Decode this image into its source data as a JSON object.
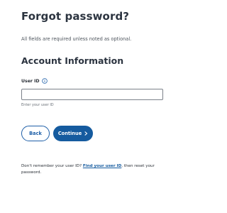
{
  "page": {
    "title": "Forgot password?",
    "required_note": "All fields are required unless noted as optional."
  },
  "section": {
    "title": "Account Information"
  },
  "user_id_field": {
    "label": "User ID",
    "value": "",
    "placeholder": "",
    "helper_text": "Enter your user ID"
  },
  "buttons": {
    "back_label": "Back",
    "continue_label": "Continue"
  },
  "footer": {
    "text_before": "Don't remember your user ID? ",
    "link_text": "Find your user ID",
    "text_after": ", then reset your password."
  },
  "icons": {
    "info": "info-icon",
    "continue": "chevron-right-icon"
  },
  "colors": {
    "primary": "#155b9f",
    "heading": "#2c3440",
    "link": "#155b9f"
  }
}
